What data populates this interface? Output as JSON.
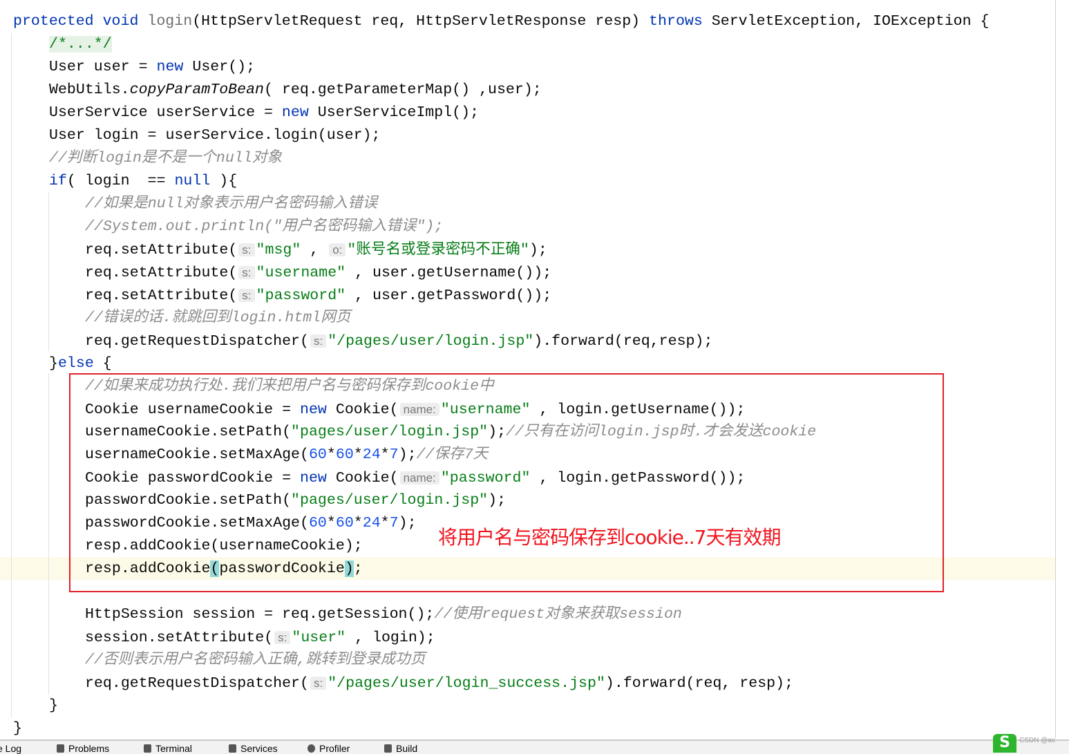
{
  "colors": {
    "keyword": "#0033b3",
    "string": "#067d17",
    "comment": "#8c8c8c",
    "number": "#1750eb",
    "annotation": "#f0141e",
    "box": "#e0202a"
  },
  "code": [
    {
      "indent": 0,
      "t": [
        [
          "k",
          "protected void "
        ],
        [
          "g",
          "login"
        ],
        [
          "p",
          "(HttpServletRequest req, HttpServletResponse resp) "
        ],
        [
          "k",
          "throws"
        ],
        [
          "p",
          " ServletException, IOException {"
        ]
      ]
    },
    {
      "indent": 1,
      "t": [
        [
          "f",
          "/*...*/"
        ]
      ]
    },
    {
      "indent": 1,
      "t": [
        [
          "p",
          "User user = "
        ],
        [
          "k",
          "new"
        ],
        [
          "p",
          " User();"
        ]
      ]
    },
    {
      "indent": 1,
      "t": [
        [
          "p",
          "WebUtils."
        ],
        [
          "i",
          "copyParamToBean"
        ],
        [
          "p",
          "( req.getParameterMap() ,user);"
        ]
      ]
    },
    {
      "indent": 1,
      "t": [
        [
          "p",
          "UserService userService = "
        ],
        [
          "k",
          "new"
        ],
        [
          "p",
          " UserServiceImpl();"
        ]
      ]
    },
    {
      "indent": 1,
      "t": [
        [
          "p",
          "User login = userService.login(user);"
        ]
      ]
    },
    {
      "indent": 1,
      "t": [
        [
          "c",
          "//判断login是不是一个null对象"
        ]
      ]
    },
    {
      "indent": 1,
      "t": [
        [
          "k",
          "if"
        ],
        [
          "p",
          "( login  == "
        ],
        [
          "k",
          "null"
        ],
        [
          "p",
          " ){"
        ]
      ]
    },
    {
      "indent": 2,
      "t": [
        [
          "c",
          "//如果是null对象表示用户名密码输入错误"
        ]
      ]
    },
    {
      "indent": 2,
      "t": [
        [
          "c",
          "//System.out.println(\"用户名密码输入错误\");"
        ]
      ]
    },
    {
      "indent": 2,
      "t": [
        [
          "p",
          "req.setAttribute("
        ],
        [
          "h",
          "s:"
        ],
        [
          "s",
          "\"msg\""
        ],
        [
          "p",
          " , "
        ],
        [
          "h",
          "o:"
        ],
        [
          "s",
          "\"账号名或登录密码不正确\""
        ],
        [
          "p",
          ");"
        ]
      ]
    },
    {
      "indent": 2,
      "t": [
        [
          "p",
          "req.setAttribute("
        ],
        [
          "h",
          "s:"
        ],
        [
          "s",
          "\"username\""
        ],
        [
          "p",
          " , user.getUsername());"
        ]
      ]
    },
    {
      "indent": 2,
      "t": [
        [
          "p",
          "req.setAttribute("
        ],
        [
          "h",
          "s:"
        ],
        [
          "s",
          "\"password\""
        ],
        [
          "p",
          " , user.getPassword());"
        ]
      ]
    },
    {
      "indent": 2,
      "t": [
        [
          "c",
          "//错误的话.就跳回到login.html网页"
        ]
      ]
    },
    {
      "indent": 2,
      "t": [
        [
          "p",
          "req.getRequestDispatcher("
        ],
        [
          "h",
          "s:"
        ],
        [
          "s",
          "\"/pages/user/login.jsp\""
        ],
        [
          "p",
          ").forward(req,resp);"
        ]
      ]
    },
    {
      "indent": 1,
      "t": [
        [
          "p",
          "}"
        ],
        [
          "k",
          "else"
        ],
        [
          "p",
          " {"
        ]
      ]
    },
    {
      "indent": 2,
      "t": [
        [
          "c",
          "//如果来成功执行处.我们来把用户名与密码保存到cookie中"
        ]
      ]
    },
    {
      "indent": 2,
      "t": [
        [
          "p",
          "Cookie usernameCookie = "
        ],
        [
          "k",
          "new"
        ],
        [
          "p",
          " Cookie("
        ],
        [
          "h",
          "name:"
        ],
        [
          "s",
          "\"username\""
        ],
        [
          "p",
          " , login.getUsername());"
        ]
      ]
    },
    {
      "indent": 2,
      "t": [
        [
          "p",
          "usernameCookie.setPath("
        ],
        [
          "s",
          "\"pages/user/login.jsp\""
        ],
        [
          "p",
          ");"
        ],
        [
          "c",
          "//只有在访问login.jsp时.才会发送cookie"
        ]
      ]
    },
    {
      "indent": 2,
      "t": [
        [
          "p",
          "usernameCookie.setMaxAge("
        ],
        [
          "n",
          "60"
        ],
        [
          "p",
          "*"
        ],
        [
          "n",
          "60"
        ],
        [
          "p",
          "*"
        ],
        [
          "n",
          "24"
        ],
        [
          "p",
          "*"
        ],
        [
          "n",
          "7"
        ],
        [
          "p",
          ");"
        ],
        [
          "c",
          "//保存7天"
        ]
      ]
    },
    {
      "indent": 2,
      "t": [
        [
          "p",
          "Cookie passwordCookie = "
        ],
        [
          "k",
          "new"
        ],
        [
          "p",
          " Cookie("
        ],
        [
          "h",
          "name:"
        ],
        [
          "s",
          "\"password\""
        ],
        [
          "p",
          " , login.getPassword());"
        ]
      ]
    },
    {
      "indent": 2,
      "t": [
        [
          "p",
          "passwordCookie.setPath("
        ],
        [
          "s",
          "\"pages/user/login.jsp\""
        ],
        [
          "p",
          ");"
        ]
      ]
    },
    {
      "indent": 2,
      "t": [
        [
          "p",
          "passwordCookie.setMaxAge("
        ],
        [
          "n",
          "60"
        ],
        [
          "p",
          "*"
        ],
        [
          "n",
          "60"
        ],
        [
          "p",
          "*"
        ],
        [
          "n",
          "24"
        ],
        [
          "p",
          "*"
        ],
        [
          "n",
          "7"
        ],
        [
          "p",
          ");"
        ]
      ]
    },
    {
      "indent": 2,
      "t": [
        [
          "p",
          "resp.addCookie(usernameCookie);"
        ]
      ]
    },
    {
      "indent": 2,
      "t": [
        [
          "p",
          "resp.addCookie"
        ],
        [
          "b",
          "("
        ],
        [
          "p",
          "passwordCookie"
        ],
        [
          "b",
          ")"
        ],
        [
          "p",
          ";"
        ]
      ]
    },
    {
      "indent": 0,
      "t": []
    },
    {
      "indent": 2,
      "t": [
        [
          "p",
          "HttpSession session = req.getSession();"
        ],
        [
          "c",
          "//使用request对象来获取session"
        ]
      ]
    },
    {
      "indent": 2,
      "t": [
        [
          "p",
          "session.setAttribute("
        ],
        [
          "h",
          "s:"
        ],
        [
          "s",
          "\"user\""
        ],
        [
          "p",
          " , login);"
        ]
      ]
    },
    {
      "indent": 2,
      "t": [
        [
          "c",
          "//否则表示用户名密码输入正确,跳转到登录成功页"
        ]
      ]
    },
    {
      "indent": 2,
      "t": [
        [
          "p",
          "req.getRequestDispatcher("
        ],
        [
          "h",
          "s:"
        ],
        [
          "s",
          "\"/pages/user/login_success.jsp\""
        ],
        [
          "p",
          ").forward(req, resp);"
        ]
      ]
    },
    {
      "indent": 1,
      "t": [
        [
          "p",
          "}"
        ]
      ]
    },
    {
      "indent": 0,
      "t": [
        [
          "p",
          "}"
        ]
      ]
    }
  ],
  "annotation": "将用户名与密码保存到cookie..7天有效期",
  "bottom_tabs": [
    {
      "label": "e Log",
      "icon": "log-icon"
    },
    {
      "label": "Problems",
      "icon": "problems-icon"
    },
    {
      "label": "Terminal",
      "icon": "terminal-icon"
    },
    {
      "label": "Services",
      "icon": "services-icon"
    },
    {
      "label": "Profiler",
      "icon": "profiler-icon"
    },
    {
      "label": "Build",
      "icon": "build-icon"
    }
  ],
  "watermark": "CSDN @ac"
}
